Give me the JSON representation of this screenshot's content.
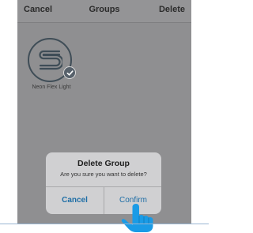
{
  "header": {
    "cancel_label": "Cancel",
    "title": "Groups",
    "delete_label": "Delete"
  },
  "group_tile": {
    "label": "Neon Flex Light",
    "selected": true,
    "icon": "neon-flex-light-icon"
  },
  "dialog": {
    "title": "Delete Group",
    "message": "Are you sure you want to delete?",
    "cancel_label": "Cancel",
    "confirm_label": "Confirm"
  },
  "colors": {
    "overlay": "#8f8f91",
    "dialog": "#d0d0d2",
    "link": "#1f6ea6",
    "pointer_hand": "#1a9be6"
  }
}
